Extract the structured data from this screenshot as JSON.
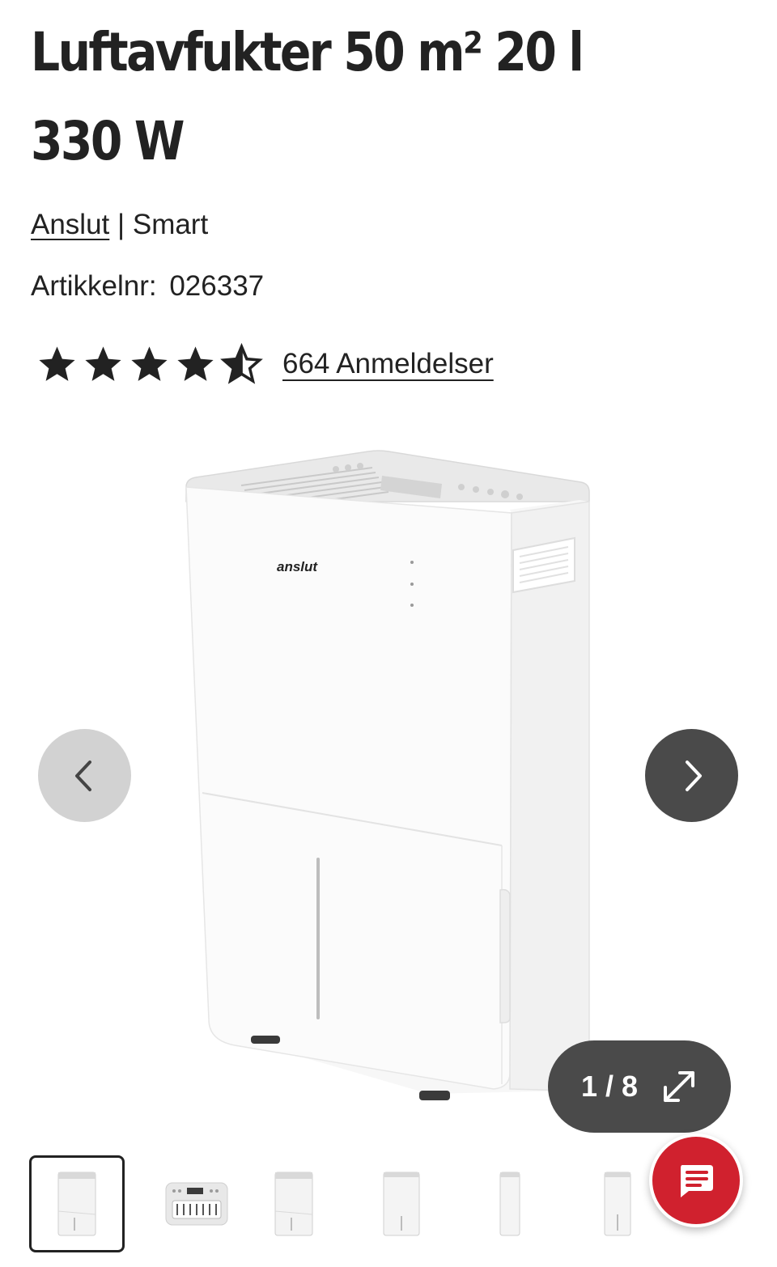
{
  "product": {
    "title_line1": "Luftavfukter 50 m² 20 l",
    "title_line2": "330 W",
    "brand": "Anslut",
    "brand_separator": "|",
    "series": "Smart",
    "sku_label": "Artikkelnr:",
    "sku": "026337"
  },
  "rating": {
    "value": 4.5,
    "max": 5,
    "reviews_label": "664 Anmeldelser"
  },
  "gallery": {
    "counter": "1 / 8",
    "current_index": 1,
    "total": 8,
    "device_logo": "anslut",
    "prev_icon": "chevron-left-icon",
    "next_icon": "chevron-right-icon",
    "expand_icon": "expand-icon"
  },
  "colors": {
    "text": "#222222",
    "nav_prev_bg": "#d2d2d2",
    "nav_next_bg": "#4a4a4a",
    "chat_bg": "#d0212e"
  },
  "chat": {
    "icon": "chat-icon"
  }
}
